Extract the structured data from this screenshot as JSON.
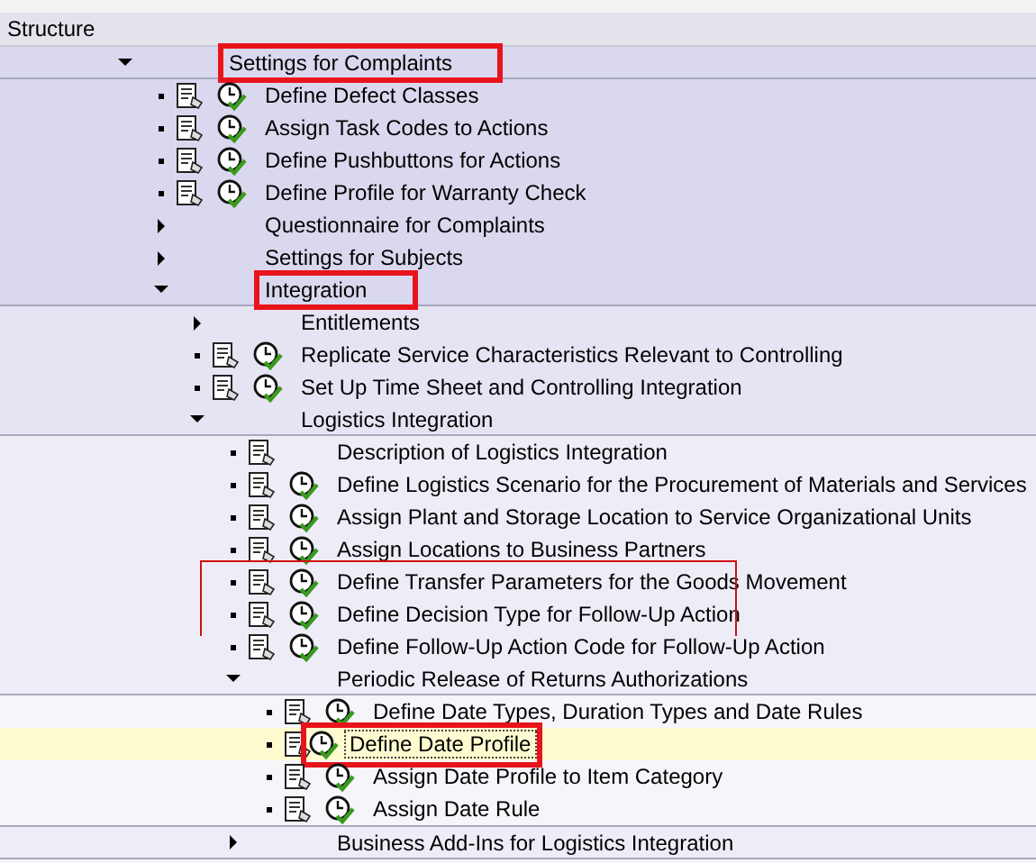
{
  "header": {
    "title": "Structure"
  },
  "tree": [
    {
      "label": "Settings for Complaints",
      "kind": "folder",
      "expanded": true,
      "highlighted": true,
      "children": [
        {
          "label": "Define Defect Classes",
          "kind": "activity"
        },
        {
          "label": "Assign Task Codes to Actions",
          "kind": "activity"
        },
        {
          "label": "Define Pushbuttons for Actions",
          "kind": "activity"
        },
        {
          "label": "Define Profile for Warranty Check",
          "kind": "activity"
        },
        {
          "label": "Questionnaire for Complaints",
          "kind": "folder",
          "expanded": false
        },
        {
          "label": "Settings for Subjects",
          "kind": "folder",
          "expanded": false
        },
        {
          "label": "Integration",
          "kind": "folder",
          "expanded": true,
          "highlighted": true,
          "children": [
            {
              "label": "Entitlements",
              "kind": "folder",
              "expanded": false
            },
            {
              "label": "Replicate Service Characteristics Relevant to Controlling",
              "kind": "activity"
            },
            {
              "label": "Set Up Time Sheet and Controlling Integration",
              "kind": "activity"
            },
            {
              "label": "Logistics Integration",
              "kind": "folder",
              "expanded": true,
              "children": [
                {
                  "label": "Description of Logistics Integration",
                  "kind": "description"
                },
                {
                  "label": "Define Logistics Scenario for the Procurement of Materials and Services",
                  "kind": "activity"
                },
                {
                  "label": "Assign Plant and Storage Location to Service Organizational Units",
                  "kind": "activity"
                },
                {
                  "label": "Assign Locations to Business Partners",
                  "kind": "activity"
                },
                {
                  "label": "Define Transfer Parameters for the Goods Movement",
                  "kind": "activity"
                },
                {
                  "label": "Define Decision Type for Follow-Up Action",
                  "kind": "activity"
                },
                {
                  "label": "Define Follow-Up Action Code for Follow-Up Action",
                  "kind": "activity"
                },
                {
                  "label": "Periodic Release of Returns Authorizations",
                  "kind": "folder",
                  "expanded": true,
                  "children": [
                    {
                      "label": "Define Date Types, Duration Types and Date Rules",
                      "kind": "activity"
                    },
                    {
                      "label": "Define Date Profile",
                      "kind": "activity",
                      "selected": true,
                      "highlighted": true
                    },
                    {
                      "label": "Assign Date Profile to Item Category",
                      "kind": "activity"
                    },
                    {
                      "label": "Assign Date Rule",
                      "kind": "activity"
                    }
                  ]
                },
                {
                  "label": "Business Add-Ins for Logistics Integration",
                  "kind": "folder",
                  "expanded": false
                }
              ]
            }
          ]
        }
      ]
    }
  ]
}
